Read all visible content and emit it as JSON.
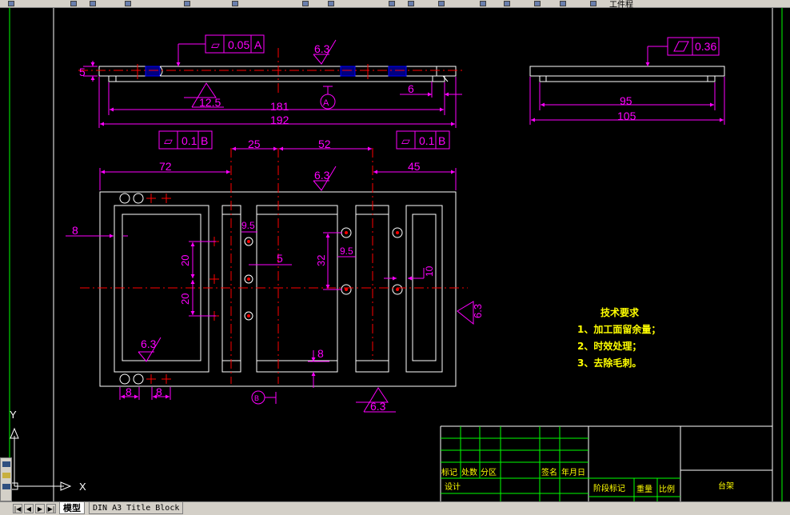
{
  "toolbar": {
    "title_fragment": "工件程"
  },
  "colors": {
    "background": "#000000",
    "magenta": "#ff00ff",
    "white": "#ffffff",
    "red": "#ff0000",
    "green": "#00ff00",
    "yellow": "#ffff00"
  },
  "drawing": {
    "top_view": {
      "flatness": {
        "symbol": "⏥",
        "value": "0.05",
        "datum": "A"
      },
      "roughness": "6.3",
      "roughness_bottom": "12.5",
      "thickness": "5",
      "dims": {
        "inner": "181",
        "overall": "192",
        "right_step": "6"
      },
      "datum_label": "A"
    },
    "right_view": {
      "tolerance": {
        "symbol": "▱",
        "value": "0.36"
      },
      "dims": {
        "inner": "95",
        "overall": "105"
      }
    },
    "plan_view": {
      "fcf_left": {
        "symbol": "⏥",
        "value": "0.1",
        "datum": "B"
      },
      "fcf_right": {
        "symbol": "⏥",
        "value": "0.1",
        "datum": "B"
      },
      "dims": {
        "d25": "25",
        "d52": "52",
        "d72": "72",
        "d45": "45",
        "d8_left": "8",
        "d9_5_a": "9.5",
        "d20_a": "20",
        "d20_b": "20",
        "d5": "5",
        "d32": "32",
        "d9_5_b": "9.5",
        "d10": "10",
        "d8_bottom": "8",
        "d8_bl": "8",
        "d8_bl2": "8"
      },
      "roughness_top": "6.3",
      "roughness_inner": "6.3",
      "roughness_right": "6.3",
      "roughness_bottom": "6.3",
      "datum_label": "B"
    },
    "tech_requirements": {
      "title": "技术要求",
      "items": [
        "1、加工面留余量；",
        "2、时效处理；",
        "3、去除毛刺。"
      ]
    }
  },
  "title_block": {
    "row_labels": [
      "标记",
      "处数",
      "分区",
      "签名",
      "年月日"
    ],
    "design": "设计",
    "stage": "阶段标记",
    "weight": "重量",
    "scale": "比例",
    "part_name": "台架"
  },
  "ucs": {
    "y": "Y",
    "x": "X"
  },
  "tabs": {
    "model": "模型",
    "layout": "DIN A3 Title Block"
  },
  "nav": {
    "first": "|◀",
    "prev": "◀",
    "next": "▶",
    "last": "▶|"
  }
}
